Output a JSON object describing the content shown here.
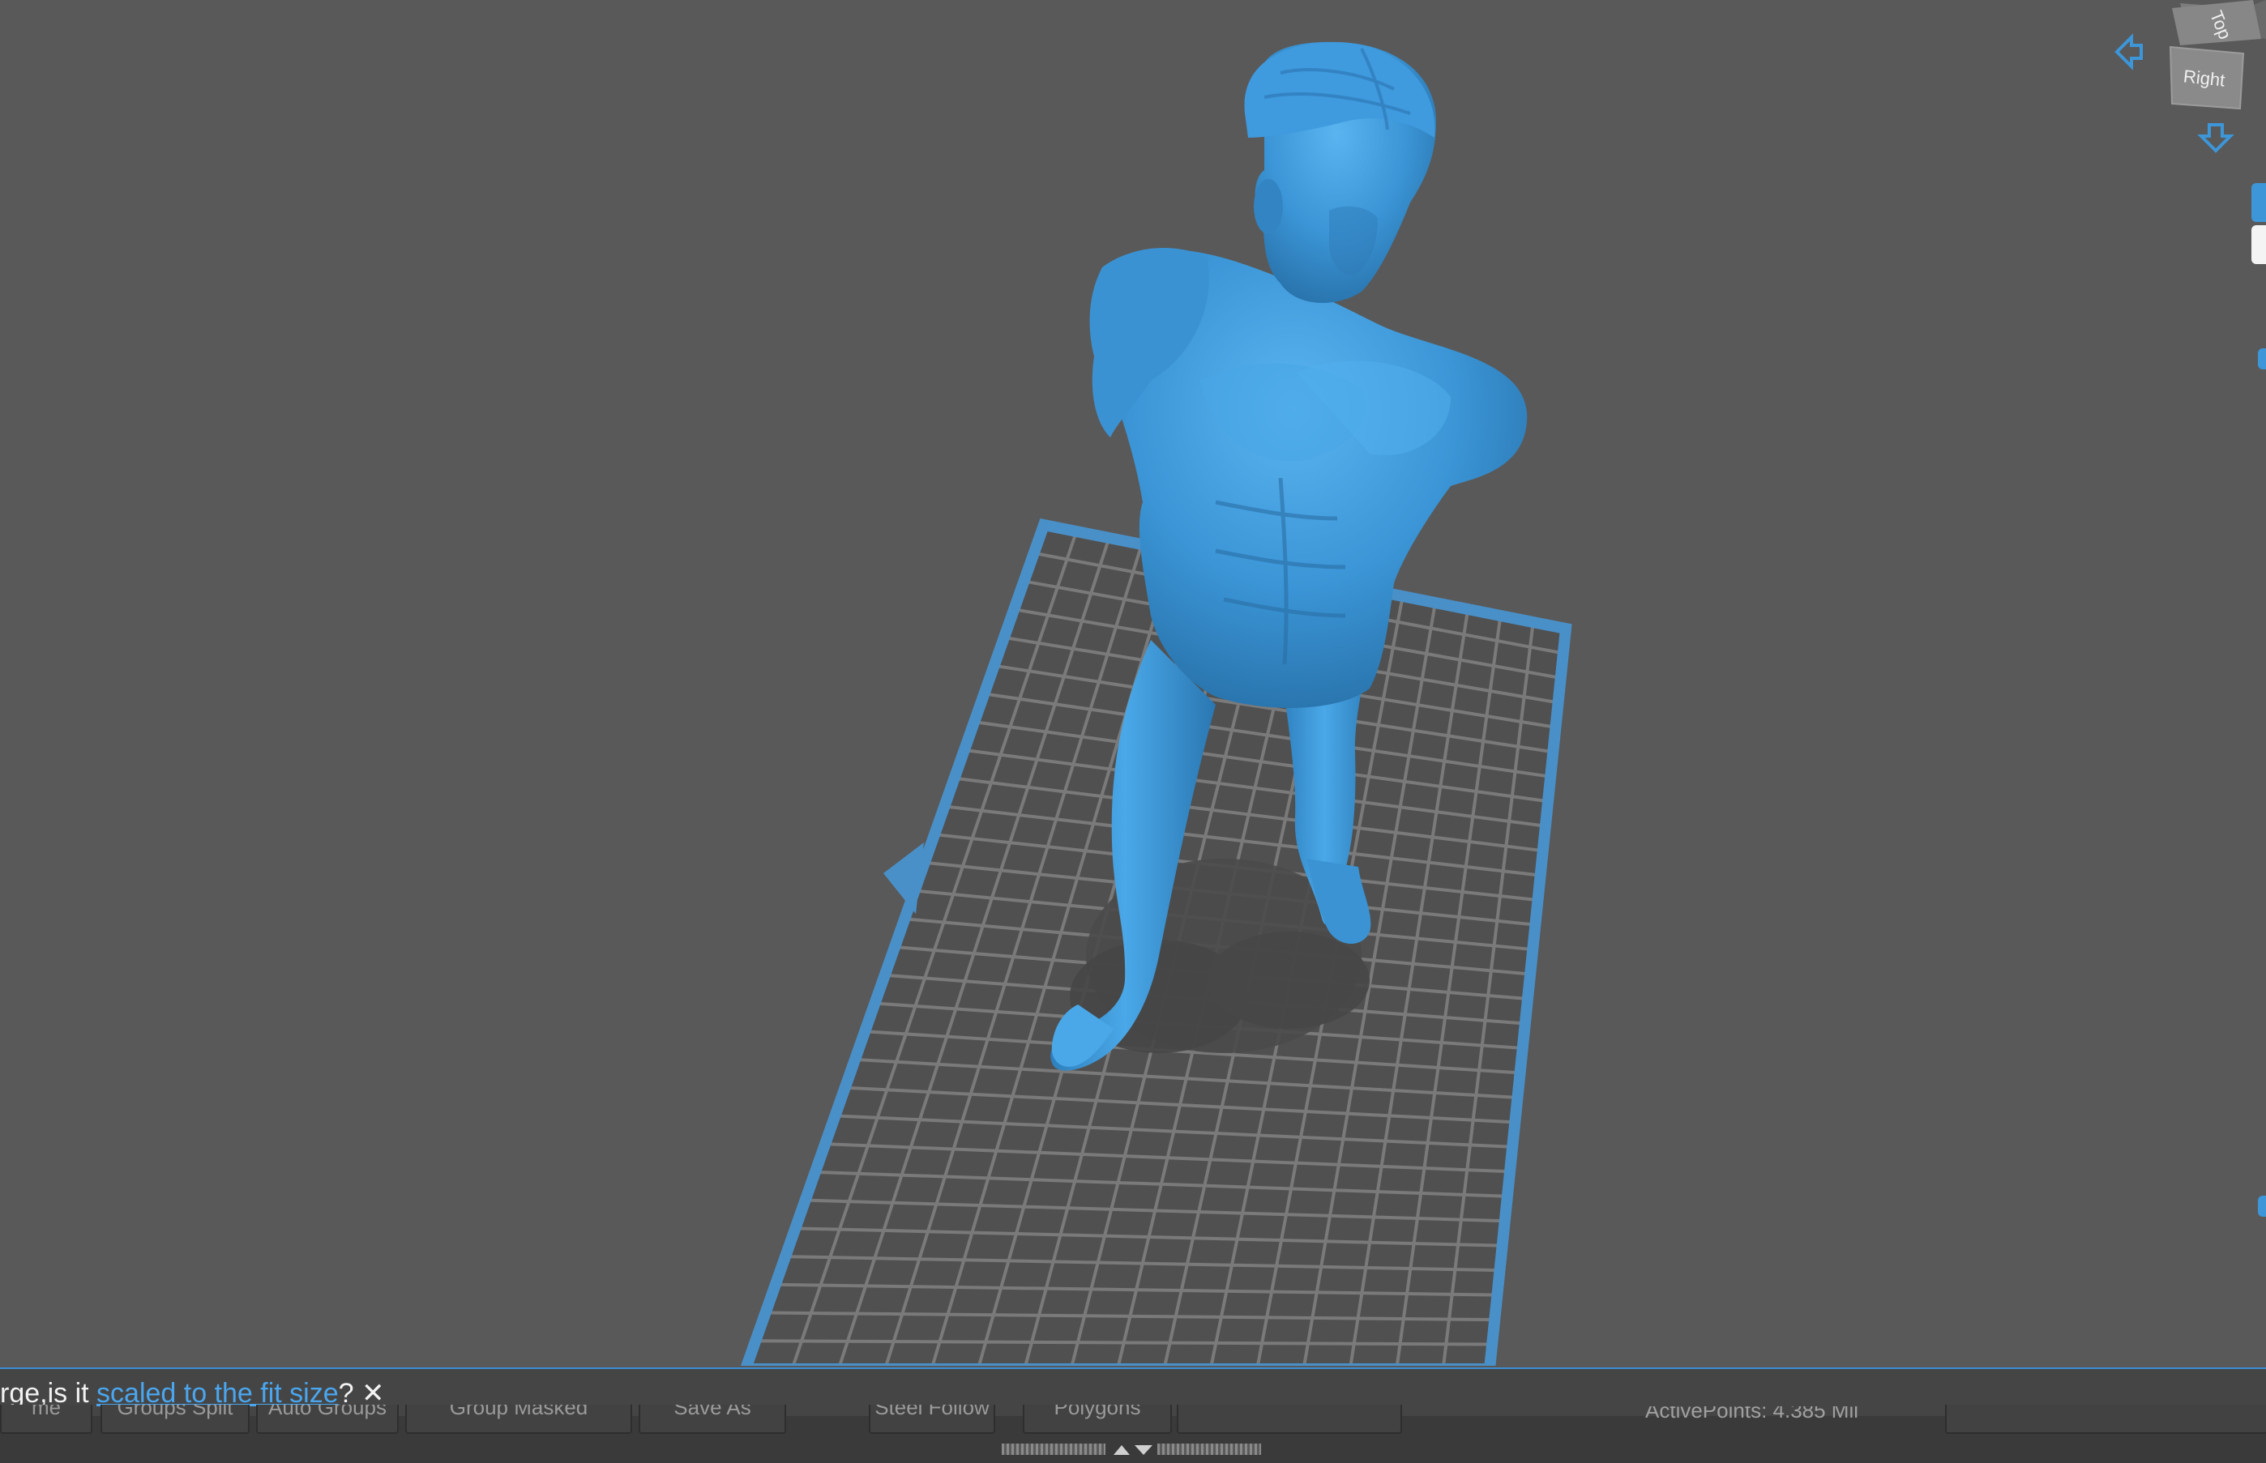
{
  "viewcube": {
    "top_label": "Top",
    "right_label": "Right",
    "arrow_left_icon": "arrow-left-icon",
    "arrow_down_icon": "arrow-down-icon"
  },
  "notification": {
    "text_before": "rge,is it ",
    "link_text": "scaled to the fit size",
    "text_after": "?",
    "close_symbol": "✕"
  },
  "toolbar": {
    "buttons": [
      {
        "label": "me"
      },
      {
        "label": "Groups Split"
      },
      {
        "label": "Auto Groups"
      },
      {
        "label": "Group Masked"
      },
      {
        "label": "Save As"
      },
      {
        "label": "Steel Follow"
      },
      {
        "label": "Polygons"
      },
      {
        "label": ""
      }
    ],
    "status": "ActivePoints: 4.385 Mil",
    "handle_icon": "collapse-expand-icon"
  },
  "colors": {
    "viewport_bg": "#595959",
    "model": "#3d96d8",
    "build_plate_border": "#4a90c8",
    "accent": "#3d8fd6"
  }
}
